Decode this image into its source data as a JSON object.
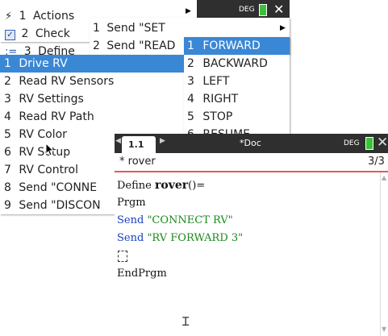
{
  "top_menu": {
    "items": [
      {
        "num": "1",
        "label": "Actions",
        "icon": "lightning-icon"
      },
      {
        "num": "2",
        "label": "Check",
        "icon": "checkbox-icon"
      },
      {
        "num": "3",
        "label": "Define",
        "icon": "define-icon"
      }
    ],
    "status": {
      "mode": "DEG"
    }
  },
  "main_menu": {
    "items": [
      {
        "num": "1",
        "label": "Drive RV"
      },
      {
        "num": "2",
        "label": "Read RV Sensors"
      },
      {
        "num": "3",
        "label": "RV Settings"
      },
      {
        "num": "4",
        "label": "Read RV Path"
      },
      {
        "num": "5",
        "label": "RV Color"
      },
      {
        "num": "6",
        "label": "RV Setup"
      },
      {
        "num": "7",
        "label": "RV Control"
      },
      {
        "num": "8",
        "label": "Send \"CONNE"
      },
      {
        "num": "9",
        "label": "Send \"DISCON"
      }
    ]
  },
  "send_menu": {
    "items": [
      {
        "num": "1",
        "label": "Send \"SET"
      },
      {
        "num": "2",
        "label": "Send \"READ"
      }
    ]
  },
  "drive_menu": {
    "items": [
      {
        "num": "1",
        "label": "FORWARD"
      },
      {
        "num": "2",
        "label": "BACKWARD"
      },
      {
        "num": "3",
        "label": "LEFT"
      },
      {
        "num": "4",
        "label": "RIGHT"
      },
      {
        "num": "5",
        "label": "STOP"
      },
      {
        "num": "6",
        "label": "RESUME"
      }
    ]
  },
  "window": {
    "tab_label": "1.1",
    "doc_title": "*Doc",
    "mode": "DEG",
    "program_name": "* rover",
    "line_counter": "3/3",
    "code": {
      "define_prefix": "Define ",
      "func_name": "rover",
      "func_suffix": "()=",
      "prgm": "Prgm",
      "send1_kw": "Send ",
      "send1_str": "\"CONNECT RV\"",
      "send2_kw": "Send ",
      "send2_str": "\"RV FORWARD 3\"",
      "endprgm": "EndPrgm"
    }
  }
}
